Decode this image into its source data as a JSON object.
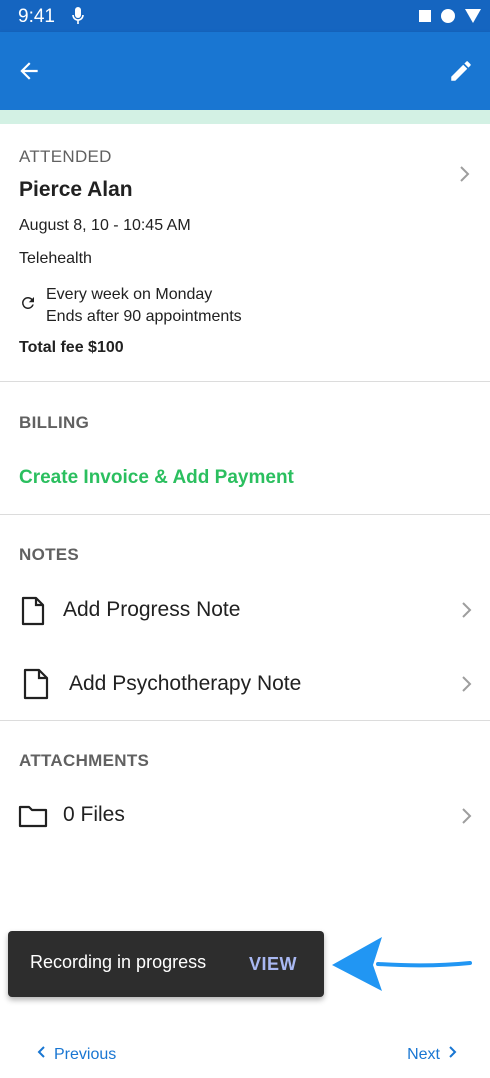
{
  "status_bar": {
    "time": "9:41",
    "icons": [
      "mic-icon",
      "square-icon",
      "circle-icon",
      "triangle-icon"
    ]
  },
  "app_bar": {
    "back_icon": "arrow-left-icon",
    "edit_icon": "pencil-icon",
    "color": "#1976d2"
  },
  "appointment": {
    "status": "ATTENDED",
    "client_name": "Pierce Alan",
    "date_time": "August 8, 10 - 10:45 AM",
    "location": "Telehealth",
    "recurrence_line1": "Every week on Monday",
    "recurrence_line2": "Ends after 90 appointments",
    "total_fee": "Total fee $100"
  },
  "billing": {
    "title": "BILLING",
    "action_label": "Create Invoice & Add Payment",
    "action_color": "#2bbf5f"
  },
  "notes": {
    "title": "NOTES",
    "items": [
      {
        "label": "Add Progress Note",
        "icon": "document-icon"
      },
      {
        "label": "Add Psychotherapy Note",
        "icon": "document-icon"
      }
    ]
  },
  "attachments": {
    "title": "ATTACHMENTS",
    "files_label": "0 Files",
    "icon": "folder-icon"
  },
  "snackbar": {
    "message": "Recording in progress",
    "action": "VIEW"
  },
  "footer": {
    "previous": "Previous",
    "next": "Next"
  }
}
